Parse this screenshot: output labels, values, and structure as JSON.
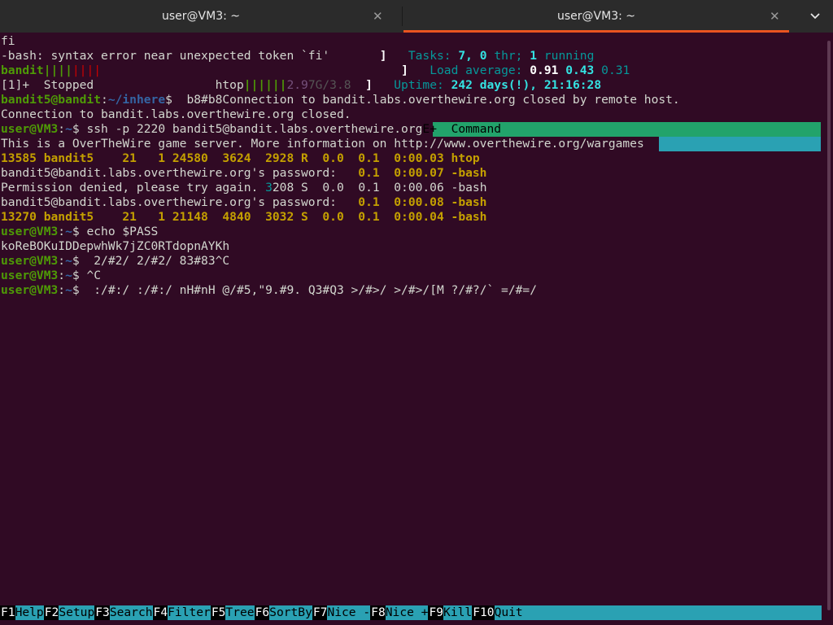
{
  "tabs": [
    {
      "title": "user@VM3: ~",
      "active": false
    },
    {
      "title": "user@VM3: ~",
      "active": true
    }
  ],
  "terminal": {
    "l1": "fi",
    "l2a": "-bash: syntax error near unexpected token `fi'",
    "l2b": "]",
    "l2c": "Tasks:",
    "l2d": "7,",
    "l2e": "0",
    "l2f": "thr;",
    "l2g": "1",
    "l2h": "running",
    "l3a": "bandit",
    "l3b": "||||",
    "l3c": "||||",
    "l3d": "]",
    "l3e": "Load average:",
    "l3f": "0.91",
    "l3g": "0.43",
    "l3h": "0.31",
    "l4a": "[1]+  Stopped                 htop",
    "l4b": "||||||",
    "l4c": "2.9",
    "l4d": "7G/3.8",
    "l4e": "]",
    "l4f": "Uptime:",
    "l4g": "242 days(!),",
    "l4h": "21:16:28",
    "l5a": "bandit5@bandit",
    "l5b": ":",
    "l5c": "~/inhere",
    "l5d": "$  b8#b8Connection to bandit.labs.overthewire.org closed by remote host.",
    "l6": "Connection to bandit.labs.overthewire.org closed.",
    "l7a": "user@VM3",
    "l7b": ":",
    "l7c": "~",
    "l7d": "$ ssh -p 2220 bandit5@bandit.labs.overthewire.org",
    "l7e": "E+  Command",
    "l8": "This is a OverTheWire game server. More information on http://www.overthewire.org/wargames",
    "l9a": "13585 bandit5    21   1 24580  3624  2928 R  0.0  0.1  0:00.03 htop",
    "l10a": "bandit5@bandit.labs.overthewire.org's password:",
    "l10b": "   0.1  0:00.07 -bash",
    "l11a": "Permission denied, please try again. ",
    "l11b": "3",
    "l11c": "208 S  0.0  0.1  0:00.06 -bash",
    "l12a": "bandit5@bandit.labs.overthewire.org's password:",
    "l12b": "   0.1  0:00.08 -bash",
    "l13a": "13270 bandit5    21   1 21148  4840  3032 S  0.0  0.1  0:00.04 -bash",
    "l14a": "user@VM3",
    "l14b": ":",
    "l14c": "~",
    "l14d": "$ echo $PASS",
    "l15": "koReBOKuIDDepwhWk7jZC0RTdopnAYKh",
    "l16a": "user@VM3",
    "l16b": ":",
    "l16c": "~",
    "l16d": "$  2/#2/ 2/#2/ 83#83^C",
    "l17a": "user@VM3",
    "l17b": ":",
    "l17c": "~",
    "l17d": "$ ^C",
    "l18a": "user@VM3",
    "l18b": ":",
    "l18c": "~",
    "l18d": "$  :/#:/ :/#:/ nH#nH @/#5,\"9.#9. Q3#Q3 >/#>/ >/#>/[M ?/#?/` =/#=/"
  },
  "fkeys": [
    {
      "num": "F1",
      "label": "Help  "
    },
    {
      "num": "F2",
      "label": "Setup "
    },
    {
      "num": "F3",
      "label": "Search"
    },
    {
      "num": "F4",
      "label": "Filter"
    },
    {
      "num": "F5",
      "label": "Tree  "
    },
    {
      "num": "F6",
      "label": "SortBy"
    },
    {
      "num": "F7",
      "label": "Nice -"
    },
    {
      "num": "F8",
      "label": "Nice +"
    },
    {
      "num": "F9",
      "label": "Kill  "
    },
    {
      "num": "F10",
      "label": "Quit"
    }
  ],
  "colors": {
    "background": "#300a24",
    "prompt_green": "#4e9a06",
    "path_blue": "#3465a4",
    "htop_cyan_bar": "#2aa1b3",
    "htop_header_green": "#22a36b",
    "active_tab_accent": "#e95420"
  },
  "icons": {
    "tab_close": "close-icon",
    "menu": "chevron-down-icon"
  }
}
